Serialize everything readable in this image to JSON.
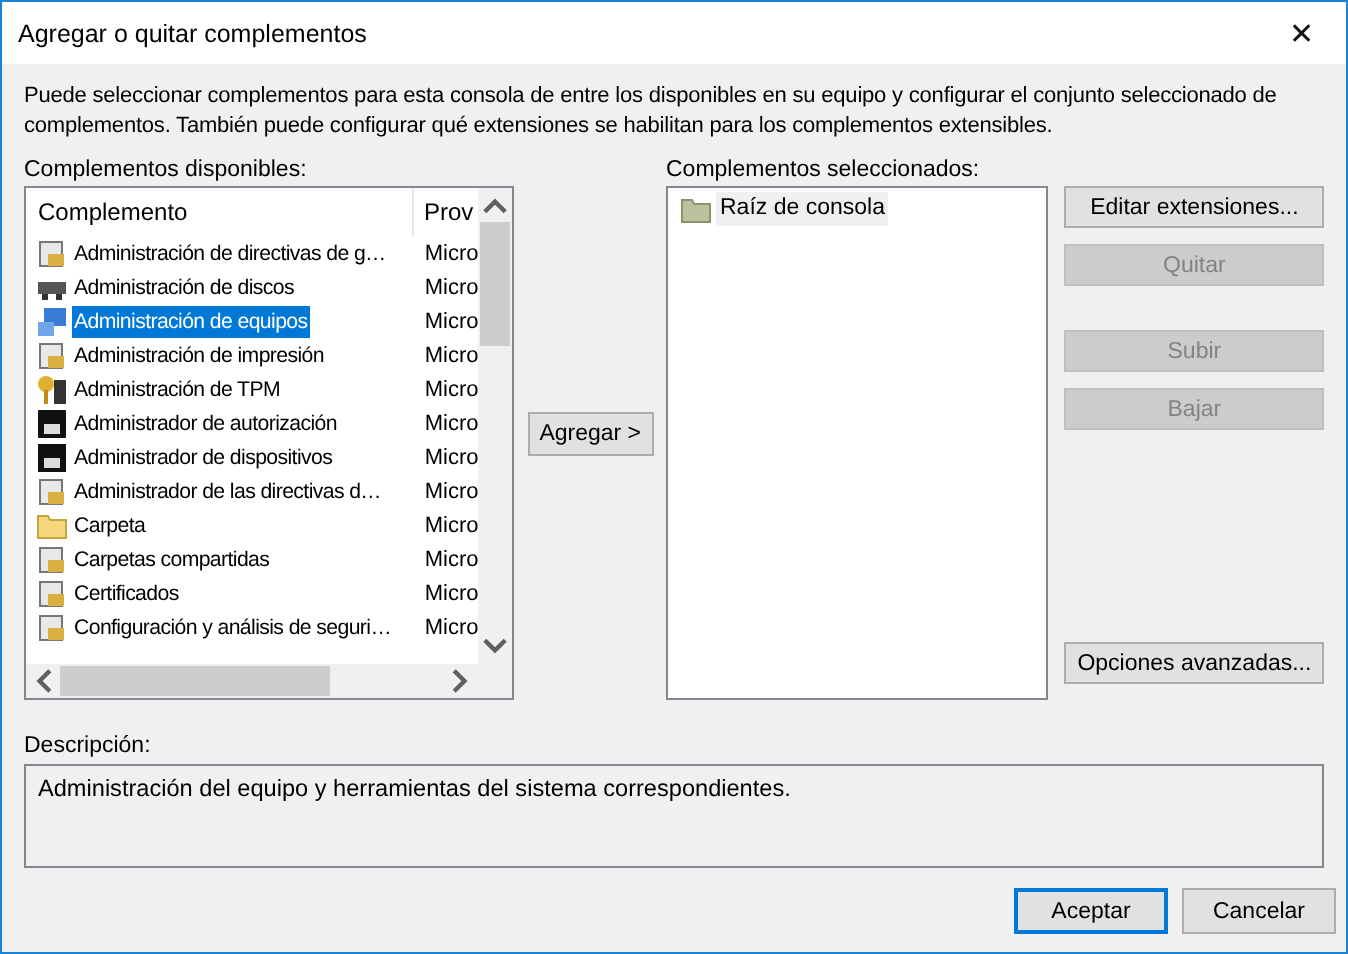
{
  "window": {
    "title": "Agregar o quitar complementos",
    "close": "✕"
  },
  "intro": "Puede seleccionar complementos para esta consola de entre los disponibles en su equipo y configurar el conjunto seleccionado de complementos. También puede configurar qué extensiones se habilitan para los complementos extensibles.",
  "available": {
    "label": "Complementos disponibles:",
    "columns": [
      "Complemento",
      "Prov"
    ],
    "rows": [
      {
        "name": "Administración de directivas de g…",
        "vendor": "Micro",
        "selected": false
      },
      {
        "name": "Administración de discos",
        "vendor": "Micro",
        "selected": false
      },
      {
        "name": "Administración de equipos",
        "vendor": "Micro",
        "selected": true
      },
      {
        "name": "Administración de impresión",
        "vendor": "Micro",
        "selected": false
      },
      {
        "name": "Administración de TPM",
        "vendor": "Micro",
        "selected": false
      },
      {
        "name": "Administrador de autorización",
        "vendor": "Micro",
        "selected": false
      },
      {
        "name": "Administrador de dispositivos",
        "vendor": "Micro",
        "selected": false
      },
      {
        "name": "Administrador de las directivas d…",
        "vendor": "Micro",
        "selected": false
      },
      {
        "name": "Carpeta",
        "vendor": "Micro",
        "selected": false
      },
      {
        "name": "Carpetas compartidas",
        "vendor": "Micro",
        "selected": false
      },
      {
        "name": "Certificados",
        "vendor": "Micro",
        "selected": false
      },
      {
        "name": "Configuración y análisis de seguri…",
        "vendor": "Micro",
        "selected": false
      }
    ]
  },
  "add_button": {
    "label": "Agregar >",
    "disabled": false
  },
  "selected_snapins": {
    "label": "Complementos seleccionados:",
    "items": [
      {
        "name": "Raíz de consola",
        "selected": true
      }
    ]
  },
  "side_buttons": [
    {
      "label": "Editar extensiones...",
      "disabled": false
    },
    {
      "label": "Quitar",
      "disabled": true
    },
    {
      "label": "Subir",
      "disabled": true
    },
    {
      "label": "Bajar",
      "disabled": true
    }
  ],
  "advanced_button": {
    "label": "Opciones avanzadas...",
    "disabled": false
  },
  "description": {
    "label": "Descripción:",
    "text": "Administración del equipo y herramientas del sistema correspondientes."
  },
  "footer_buttons": [
    {
      "label": "Aceptar",
      "default": true
    },
    {
      "label": "Cancelar",
      "default": false
    }
  ]
}
